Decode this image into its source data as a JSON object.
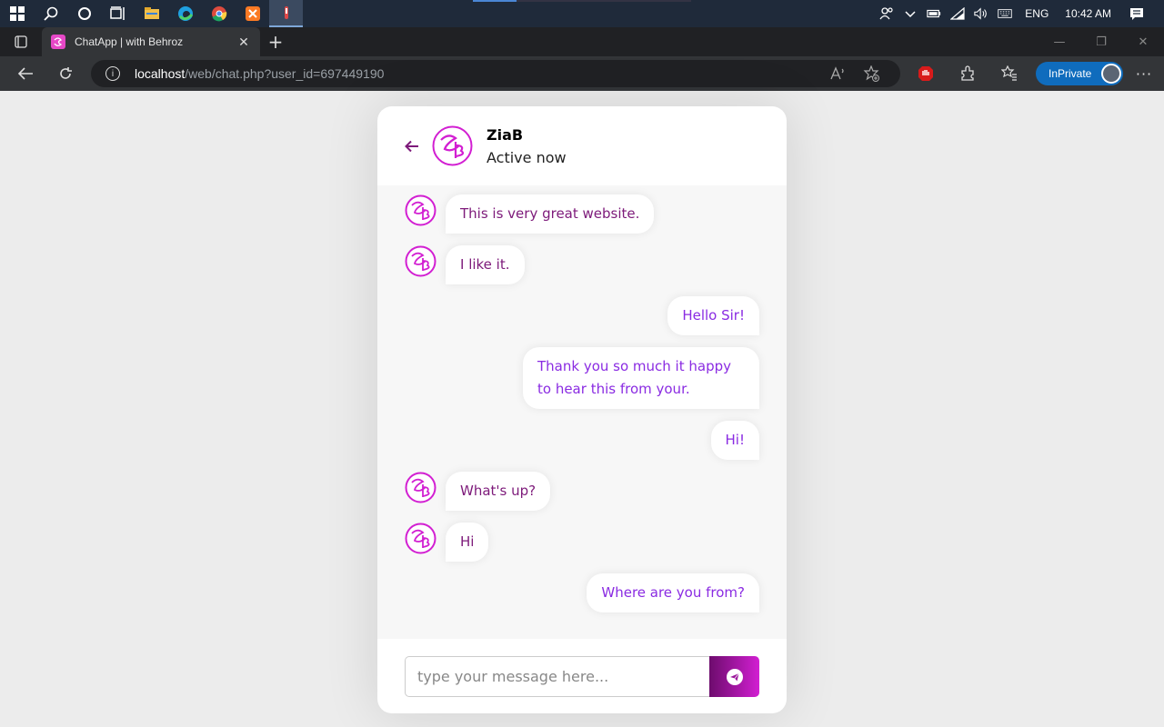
{
  "taskbar": {
    "start_icon": "windows-start-icon",
    "search_icon": "search-icon",
    "cortana_icon": "cortana-circle-icon",
    "taskview_icon": "task-view-icon",
    "apps": [
      "file-explorer-icon",
      "edge-icon",
      "chrome-icon",
      "xampp-icon",
      "app-icon"
    ],
    "tray": {
      "language": "ENG",
      "time": "10:42 AM"
    }
  },
  "browser": {
    "tab_title": "ChatApp | with Behroz",
    "url_host": "localhost",
    "url_path": "/web/chat.php?user_id=697449190",
    "inprivate_label": "InPrivate",
    "accent": "#0f6cbd"
  },
  "chat": {
    "user_name": "ZiaB",
    "status": "Active now",
    "messages": [
      {
        "dir": "in",
        "text": "This is very great website."
      },
      {
        "dir": "in",
        "text": "I like it."
      },
      {
        "dir": "out",
        "text": "Hello Sir!"
      },
      {
        "dir": "out",
        "text": "Thank you so much it happy to hear this from your."
      },
      {
        "dir": "out",
        "text": "Hi!"
      },
      {
        "dir": "in",
        "text": "What's up?"
      },
      {
        "dir": "in",
        "text": "Hi"
      },
      {
        "dir": "out",
        "text": "Where are you from?"
      }
    ],
    "input_placeholder": "type your message here...",
    "input_value": "",
    "send_icon": "telegram-send-icon",
    "colors": {
      "incoming_text": "#7d1a7a",
      "outgoing_text": "#8a2be2",
      "brand": "#d21fd2"
    }
  }
}
